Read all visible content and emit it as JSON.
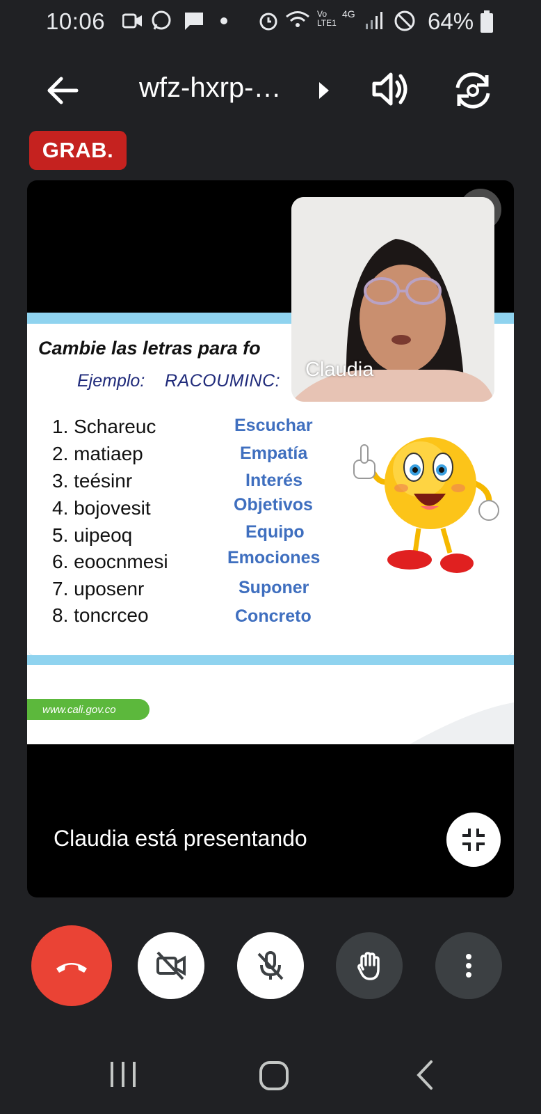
{
  "status_bar": {
    "time": "10:06",
    "network": "4G",
    "volte": "Vo\nLTE1",
    "battery": "64%"
  },
  "top_bar": {
    "meeting_code": "wfz-hxrp-…"
  },
  "recording_badge": "GRAB.",
  "slide": {
    "title": "Cambie las letras para fo",
    "example_label": "Ejemplo:",
    "example_word": "RACOUMINC:",
    "scrambled": [
      "1. Schareuc",
      "2. matiaep",
      "3. teésinr",
      "4. bojovesit",
      "5. uipeoq",
      "6. eoocnmesi",
      "7. uposenr",
      "8. toncrceo"
    ],
    "answers": [
      "Escuchar",
      "Empatía",
      "Interés",
      "Objetivos",
      "Equipo",
      "Emociones",
      "Suponer",
      "Concreto"
    ],
    "footer_url": "www.cali.gov.co"
  },
  "pip": {
    "participant_name": "Claudia"
  },
  "presenting_text": "Claudia está presentando",
  "colors": {
    "background": "#202124",
    "end_call": "#ea4335",
    "recording": "#c5221f",
    "answer_blue": "#3f6fbf",
    "slide_bar": "#8fd3ef"
  },
  "icons": {
    "back": "arrow-left-icon",
    "speaker": "volume-icon",
    "switch_camera": "camera-switch-icon",
    "minimize": "minimize-icon",
    "end_call": "phone-hangup-icon",
    "camera_off": "video-off-icon",
    "mic_off": "mic-off-icon",
    "raise_hand": "hand-icon",
    "more": "more-vert-icon"
  }
}
